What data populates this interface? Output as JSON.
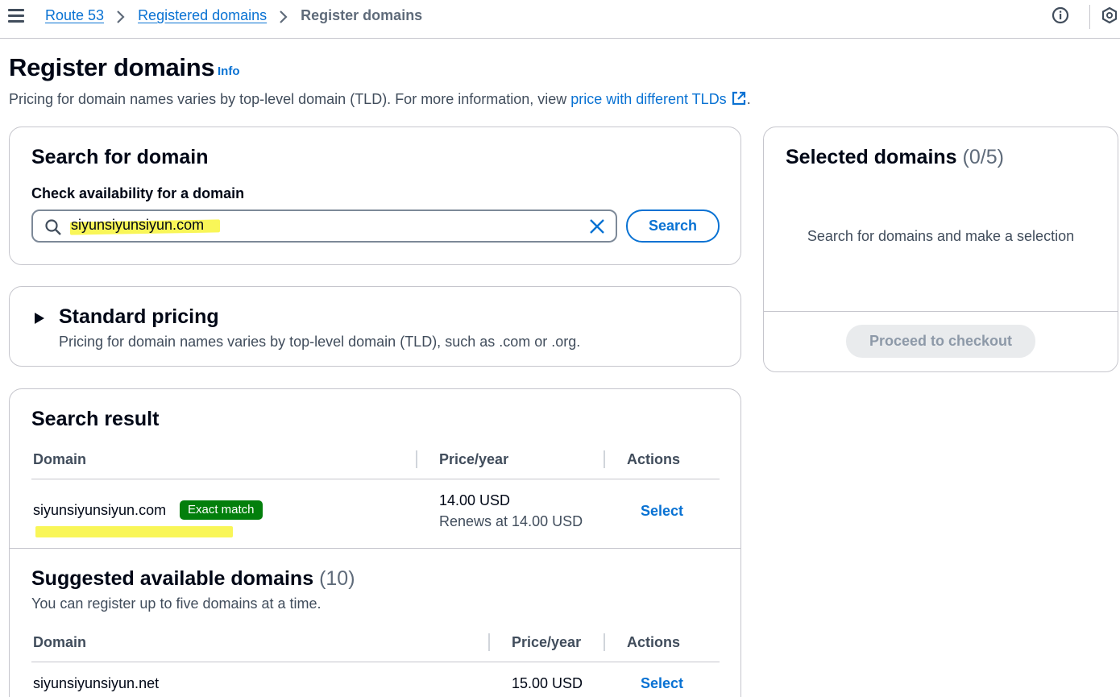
{
  "topbar": {
    "breadcrumbs": [
      "Route 53",
      "Registered domains",
      "Register domains"
    ],
    "icons": [
      "menu-icon",
      "chevron-right-icon",
      "info-icon",
      "hexagon-icon"
    ]
  },
  "header": {
    "title": "Register domains",
    "info_label": "Info",
    "description_prefix": "Pricing for domain names varies by top-level domain (TLD). For more information, view ",
    "description_link": "price with different TLDs",
    "description_suffix": "."
  },
  "search": {
    "title": "Search for domain",
    "field_label": "Check availability for a domain",
    "value": "siyunsiyunsiyun.com",
    "button_label": "Search"
  },
  "pricing": {
    "title": "Standard pricing",
    "description": "Pricing for domain names varies by top-level domain (TLD), such as .com or .org."
  },
  "selected": {
    "title": "Selected domains",
    "count": "(0/5)",
    "empty_text": "Search for domains and make a selection",
    "checkout_label": "Proceed to checkout"
  },
  "results": {
    "title": "Search result",
    "columns": [
      "Domain",
      "Price/year",
      "Actions"
    ],
    "row": {
      "domain": "siyunsiyunsiyun.com",
      "badge": "Exact match",
      "price": "14.00 USD",
      "renewal": "Renews at 14.00 USD",
      "action": "Select"
    }
  },
  "suggested": {
    "title": "Suggested available domains",
    "count": "(10)",
    "description": "You can register up to five domains at a time.",
    "columns": [
      "Domain",
      "Price/year",
      "Actions"
    ],
    "rows": [
      {
        "domain": "siyunsiyunsiyun.net",
        "price": "15.00 USD",
        "action": "Select"
      }
    ]
  },
  "colors": {
    "link": "#0972d3",
    "badge": "#037f0c",
    "highlight": "#f8f53b"
  }
}
